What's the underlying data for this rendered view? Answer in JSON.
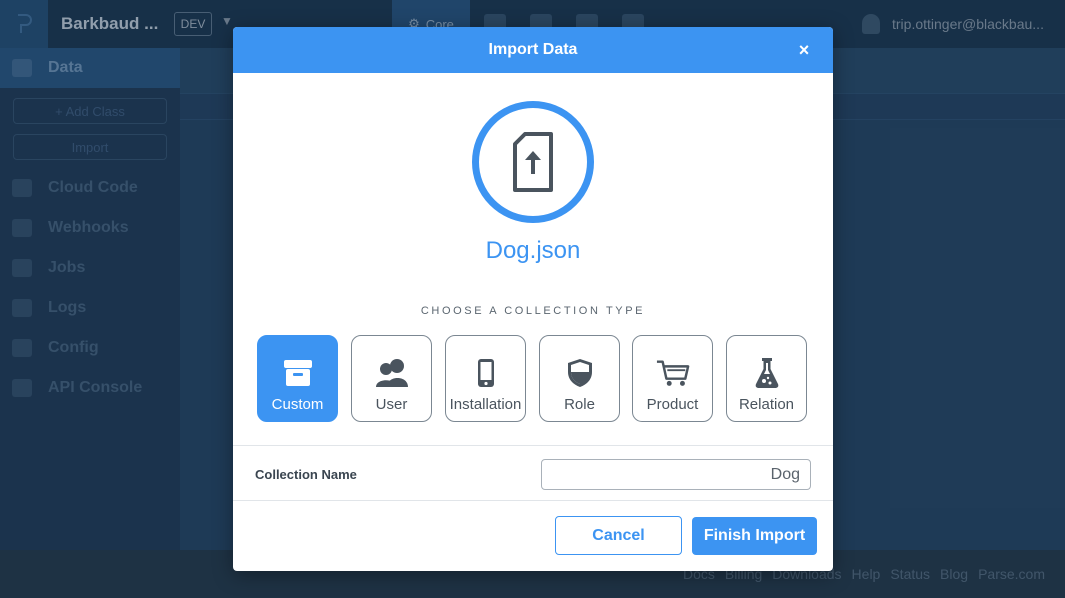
{
  "app": {
    "name": "Barkbaud ...",
    "env": "DEV",
    "nav_core": "Core",
    "user_email": "trip.ottinger@blackbau..."
  },
  "sidebar": {
    "items": [
      {
        "label": "Data",
        "icon": "grid-icon",
        "active": true
      },
      {
        "label": "Cloud Code",
        "icon": "code-file-icon"
      },
      {
        "label": "Webhooks",
        "icon": "webhook-icon"
      },
      {
        "label": "Jobs",
        "icon": "clock-icon"
      },
      {
        "label": "Logs",
        "icon": "logs-icon"
      },
      {
        "label": "Config",
        "icon": "config-icon"
      },
      {
        "label": "API Console",
        "icon": "console-icon"
      }
    ],
    "add_class_label": "+ Add Class",
    "import_label": "Import"
  },
  "footer": {
    "links": [
      "Docs",
      "Billing",
      "Downloads",
      "Help",
      "Status",
      "Blog",
      "Parse.com"
    ]
  },
  "modal": {
    "title": "Import Data",
    "close_label": "×",
    "file_name": "Dog.json",
    "choose_label": "CHOOSE A COLLECTION TYPE",
    "types": [
      {
        "label": "Custom",
        "icon": "archive-box-icon",
        "selected": true
      },
      {
        "label": "User",
        "icon": "users-icon"
      },
      {
        "label": "Installation",
        "icon": "phone-icon"
      },
      {
        "label": "Role",
        "icon": "shield-icon"
      },
      {
        "label": "Product",
        "icon": "cart-icon"
      },
      {
        "label": "Relation",
        "icon": "flask-icon"
      }
    ],
    "collection_name_label": "Collection Name",
    "collection_name_value": "Dog",
    "cancel_label": "Cancel",
    "finish_label": "Finish Import"
  },
  "colors": {
    "accent": "#3c94f2",
    "text_dark": "#4a545e"
  }
}
